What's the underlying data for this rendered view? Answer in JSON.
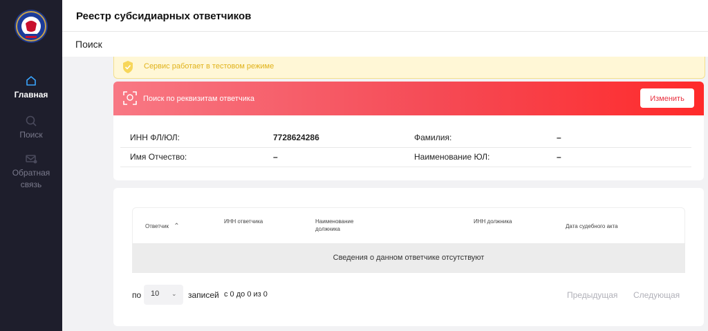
{
  "app": {
    "title": "Реестр субсидиарных ответчиков",
    "breadcrumb": "Поиск"
  },
  "sidebar": {
    "items": [
      {
        "label": "Главная",
        "icon": "home-icon",
        "active": true
      },
      {
        "label": "Поиск",
        "icon": "search-icon",
        "active": false
      },
      {
        "label": "Обратная связь",
        "icon": "mail-icon",
        "active": false
      }
    ]
  },
  "banner": {
    "text": "Сервис работает в тестовом режиме"
  },
  "search": {
    "header": "Поиск по реквизитам ответчика",
    "change_label": "Изменить",
    "fields": [
      {
        "label": "ИНН ФЛ/ЮЛ:",
        "value": "7728624286"
      },
      {
        "label": "Фамилия:",
        "value": "–"
      },
      {
        "label": "Имя Отчество:",
        "value": "–"
      },
      {
        "label": "Наименование ЮЛ:",
        "value": "–"
      }
    ]
  },
  "table": {
    "columns": [
      "Ответчик",
      "ИНН ответчика",
      "Наименование должника",
      "ИНН должника",
      "Дата судебного акта"
    ],
    "empty_text": "Сведения о данном ответчике отсутствуют",
    "footer": {
      "per_page_prefix": "по",
      "per_page_value": "10",
      "per_page_suffix": "записей",
      "info": "с 0 до 0 из 0",
      "prev": "Предыдущая",
      "next": "Следующая"
    }
  },
  "colors": {
    "sidebar": "#1e1e2c",
    "accent": "#f54a55",
    "banner_bg": "#fff7d6",
    "banner_text": "#e0b21a"
  }
}
